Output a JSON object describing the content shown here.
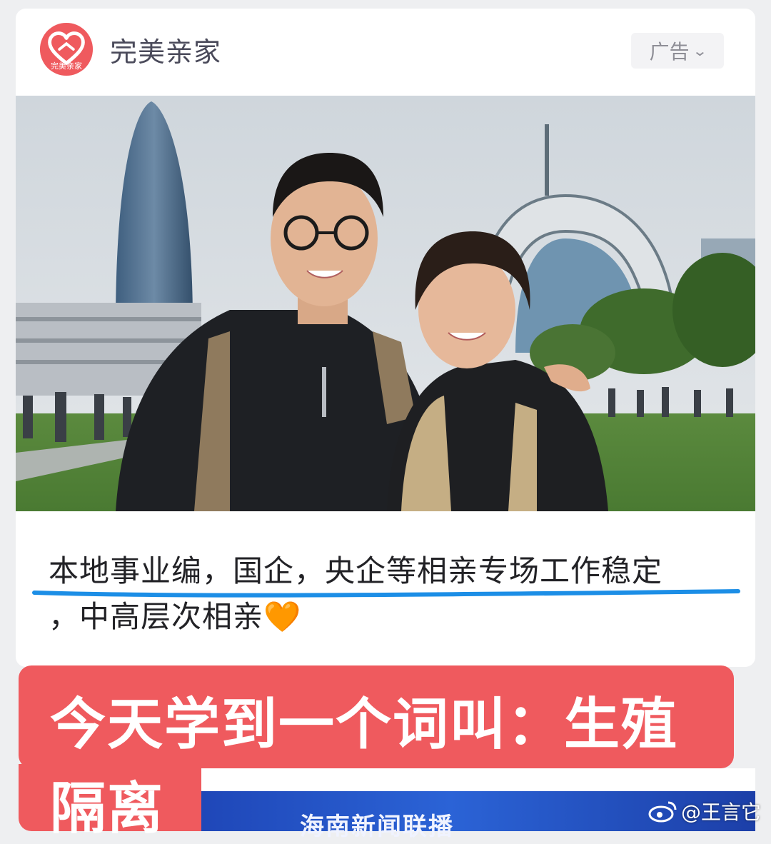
{
  "ad_card": {
    "brand_name": "完美亲家",
    "logo_small_text": "完美亲家",
    "ad_label": "广告",
    "caption_line1": "本地事业编，国企，央企等相亲专场工作稳定",
    "caption_line2": "，中高层次相亲",
    "caption_emoji": "🧡"
  },
  "overlay": {
    "headline_line1": "今天学到一个词叫：生殖",
    "headline_line2": "隔离"
  },
  "news_strip": {
    "title": "海南新闻联播"
  },
  "watermark": {
    "text": "@王言它"
  },
  "colors": {
    "brand_red": "#ef5a5e",
    "underline_blue": "#1c8ee6",
    "news_blue": "#2b63d6"
  },
  "icons": {
    "logo": "heart-icon",
    "ad_menu": "chevron-down-icon",
    "weibo": "weibo-icon"
  }
}
